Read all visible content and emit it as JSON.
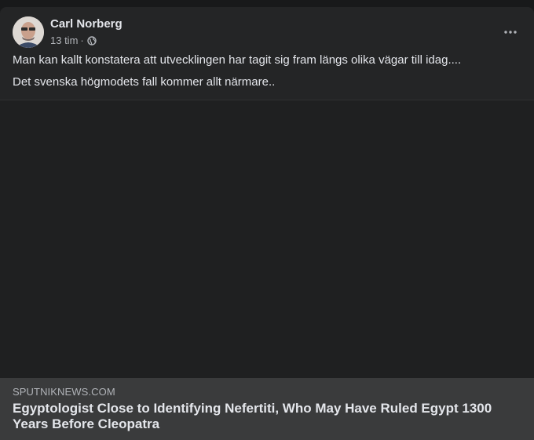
{
  "post": {
    "author": "Carl Norberg",
    "time": "13 tim",
    "separator": "·",
    "privacy_icon": "globe-icon",
    "menu_icon": "more-horizontal-icon",
    "text_lines": [
      "Man kan kallt konstatera att utvecklingen har tagit sig fram längs olika vägar till idag....",
      "Det svenska högmodets fall kommer allt närmare.."
    ]
  },
  "link_preview": {
    "domain": "SPUTNIKNEWS.COM",
    "title": "Egyptologist Close to Identifying Nefertiti, Who May Have Ruled Egypt 1300 Years Before Cleopatra"
  },
  "colors": {
    "page_bg": "#18191a",
    "card_bg": "#242526",
    "link_bg": "#3a3b3c",
    "primary_text": "#e4e6eb",
    "secondary_text": "#b0b3b8"
  }
}
